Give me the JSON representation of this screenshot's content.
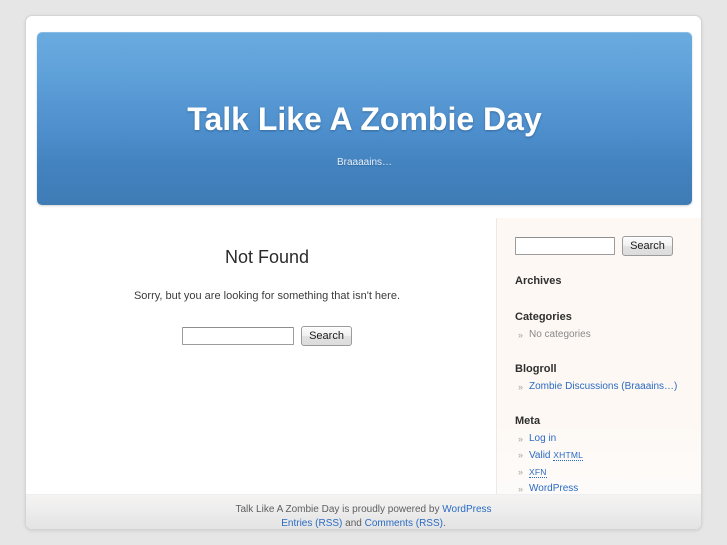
{
  "site": {
    "title": "Talk Like A Zombie Day",
    "description": "Braaaains…"
  },
  "content": {
    "page_title": "Not Found",
    "message": "Sorry, but you are looking for something that isn't here.",
    "search": {
      "value": "",
      "placeholder": "",
      "button_label": "Search"
    }
  },
  "sidebar": {
    "search": {
      "value": "",
      "placeholder": "",
      "button_label": "Search"
    },
    "widgets": [
      {
        "title": "Archives",
        "items": []
      },
      {
        "title": "Categories",
        "items": [
          {
            "label": "No categories",
            "link": false
          }
        ]
      },
      {
        "title": "Blogroll",
        "items": [
          {
            "label": "Zombie Discussions (Braaains…)",
            "link": true
          }
        ]
      },
      {
        "title": "Meta",
        "items": [
          {
            "label": "Log in",
            "link": true
          },
          {
            "label": "Valid XHTML",
            "link": true,
            "abbr": "XHTML",
            "prefix": "Valid "
          },
          {
            "label": "XFN",
            "link": true,
            "abbr": "XFN"
          },
          {
            "label": "WordPress",
            "link": true
          }
        ]
      }
    ]
  },
  "footer": {
    "info_prefix": "Talk Like A Zombie Day is proudly powered by ",
    "info_link": "WordPress",
    "entries_link": "Entries (RSS)",
    "and_text": " and ",
    "comments_link": "Comments (RSS)",
    "period": "."
  },
  "colors": {
    "header_top": "#6aabdf",
    "header_bottom": "#3f7cb6",
    "link": "#2a6bc4",
    "page_bg": "#e6e6e6",
    "sidebar_bg": "#fdf8f3"
  }
}
